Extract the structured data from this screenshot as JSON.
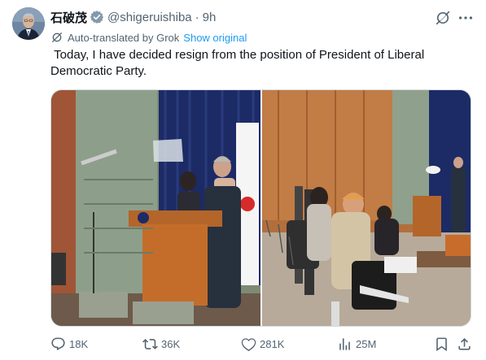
{
  "author": {
    "display_name": "石破茂",
    "handle": "@shigeruishiba",
    "separator": "·",
    "time": "9h"
  },
  "translation": {
    "label": "Auto-translated by Grok",
    "show_original": "Show original"
  },
  "tweet_text": " Today, I have decided resign from the position of President of Liberal Democratic Party.",
  "actions": {
    "replies": "18K",
    "reposts": "36K",
    "likes": "281K",
    "views": "25M"
  },
  "colors": {
    "accent": "#1d9bf0",
    "text_primary": "#0f1419",
    "text_secondary": "#536471",
    "verified": "#829aab"
  },
  "icons": [
    "verified-badge-icon",
    "grok-icon",
    "more-icon",
    "translate-icon",
    "reply-icon",
    "repost-icon",
    "like-icon",
    "views-icon",
    "bookmark-icon",
    "share-icon"
  ]
}
